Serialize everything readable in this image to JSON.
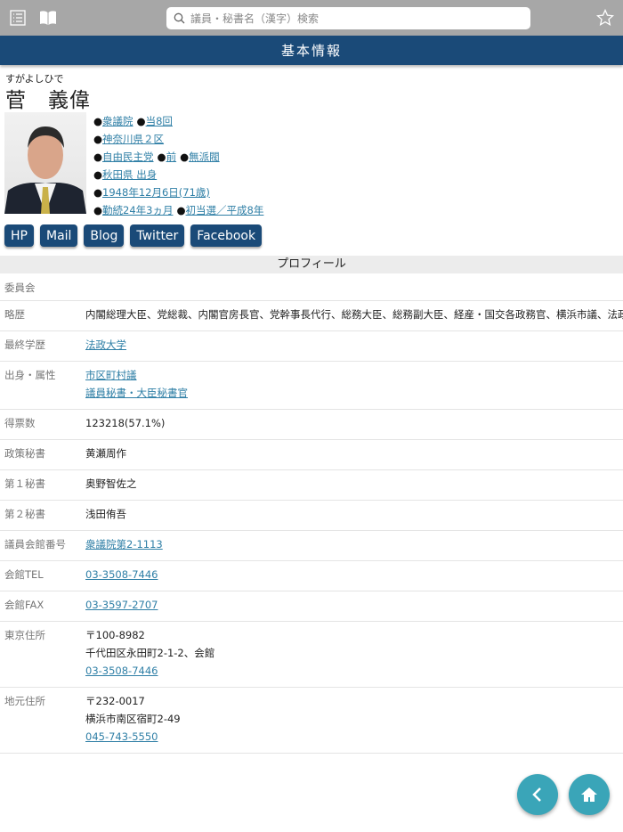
{
  "topbar": {
    "search_placeholder": "議員・秘書名（漢字）検索"
  },
  "header": {
    "title": "基本情報"
  },
  "member": {
    "kana": "すがよしひで",
    "name": "菅　義偉",
    "info": [
      [
        "衆議院",
        "当8回"
      ],
      [
        "神奈川県２区"
      ],
      [
        "自由民主党",
        "前",
        "無派閥"
      ],
      [
        "秋田県 出身"
      ],
      [
        "1948年12月6日(71歳)"
      ],
      [
        "勤続24年3ヵ月",
        "初当選／平成8年"
      ]
    ]
  },
  "buttons": [
    "HP",
    "Mail",
    "Blog",
    "Twitter",
    "Facebook"
  ],
  "profile": {
    "title": "プロフィール",
    "rows": [
      {
        "label": "委員会",
        "values": []
      },
      {
        "label": "略歴",
        "values": [
          {
            "text": "内閣総理大臣、党総裁、内閣官房長官、党幹事長代行、総務大臣、総務副大臣、経産・国交各政務官、横浜市議、法政大"
          }
        ]
      },
      {
        "label": "最終学歴",
        "values": [
          {
            "text": "法政大学",
            "link": true
          }
        ]
      },
      {
        "label": "出身・属性",
        "values": [
          {
            "text": "市区町村議",
            "link": true
          },
          {
            "text": "議員秘書・大臣秘書官",
            "link": true
          }
        ]
      },
      {
        "label": "得票数",
        "values": [
          {
            "text": "123218(57.1%)"
          }
        ]
      },
      {
        "label": "政策秘書",
        "values": [
          {
            "text": "黄瀬周作"
          }
        ]
      },
      {
        "label": "第１秘書",
        "values": [
          {
            "text": "奥野智佐之"
          }
        ]
      },
      {
        "label": "第２秘書",
        "values": [
          {
            "text": "浅田侑吾"
          }
        ]
      },
      {
        "label": "議員会館番号",
        "values": [
          {
            "text": "衆議院第2-1113",
            "link": true
          }
        ]
      },
      {
        "label": "会館TEL",
        "values": [
          {
            "text": "03-3508-7446",
            "link": true
          }
        ]
      },
      {
        "label": "会館FAX",
        "values": [
          {
            "text": "03-3597-2707",
            "link": true
          }
        ]
      },
      {
        "label": "東京住所",
        "values": [
          {
            "text": "〒100-8982"
          },
          {
            "text": "千代田区永田町2-1-2、会館"
          },
          {
            "text": "03-3508-7446",
            "link": true
          }
        ]
      },
      {
        "label": "地元住所",
        "values": [
          {
            "text": "〒232-0017"
          },
          {
            "text": "横浜市南区宿町2-49"
          },
          {
            "text": "045-743-5550",
            "link": true
          }
        ]
      }
    ]
  }
}
